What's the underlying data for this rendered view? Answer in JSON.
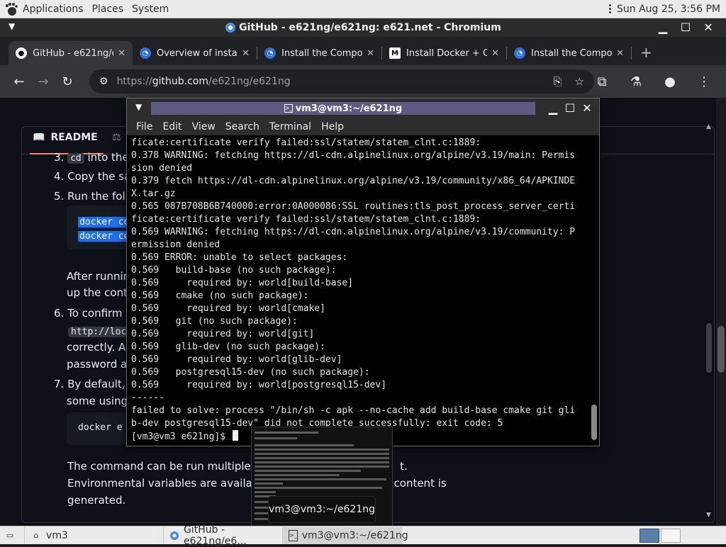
{
  "top_panel": {
    "applications_label": "Applications",
    "places_label": "Places",
    "system_label": "System",
    "clock": "Sun Aug 25,  3:56 PM"
  },
  "browser": {
    "window_title": "GitHub - e621ng/e621ng: e621.net - Chromium",
    "tabs": [
      {
        "title": "GitHub - e621ng/e",
        "favicon": "github-icon",
        "active": true
      },
      {
        "title": "Overview of insta",
        "favicon": "edge-icon",
        "active": false
      },
      {
        "title": "Install the Compo",
        "favicon": "edge-icon",
        "active": false
      },
      {
        "title": "Install Docker + C",
        "favicon": "m-icon",
        "active": false
      },
      {
        "title": "Install the Compo",
        "favicon": "edge-icon",
        "active": false
      }
    ],
    "address_scheme": "https://",
    "address_host": "github.com",
    "address_path": "/e621ng/e621ng"
  },
  "readme": {
    "tab_label": "README",
    "items": [
      {
        "num": "3.",
        "code": "cd",
        "text": " into the"
      },
      {
        "num": "4.",
        "text": "Copy the sa"
      },
      {
        "num": "5.",
        "text": "Run the follo"
      },
      {
        "num": "",
        "text": "After runnin"
      },
      {
        "num": "",
        "text": "up the conta"
      },
      {
        "num": "6.",
        "text": "To confirm t"
      },
      {
        "num": "",
        "code": "http://loc"
      },
      {
        "num": "",
        "text": "correctly. An"
      },
      {
        "num": "",
        "text": "password a"
      },
      {
        "num": "7.",
        "text": "By default, t"
      },
      {
        "num": "",
        "text": "some using"
      },
      {
        "num": "",
        "code": "docker e"
      }
    ],
    "code_block_lines": [
      "docker co",
      "docker co"
    ],
    "bottom_text": {
      "line1_start": "The command can be run multiple tin",
      "line1_end": "t.",
      "line2_start": "Environmental variables are availabl",
      "line2_end": "content is",
      "line3": "generated."
    }
  },
  "terminal": {
    "title": "vm3@vm3:~/e621ng",
    "menu": [
      "File",
      "Edit",
      "View",
      "Search",
      "Terminal",
      "Help"
    ],
    "lines": [
      "ficate:certificate verify failed:ssl/statem/statem_clnt.c:1889:",
      "0.378 WARNING: fetching https://dl-cdn.alpinelinux.org/alpine/v3.19/main: Permis",
      "sion denied",
      "0.379 fetch https://dl-cdn.alpinelinux.org/alpine/v3.19/community/x86_64/APKINDE",
      "X.tar.gz",
      "0.565 087B708B6B740000:error:0A000086:SSL routines:tls_post_process_server_certi",
      "ficate:certificate verify failed:ssl/statem/statem_clnt.c:1889:",
      "0.569 WARNING: fetching https://dl-cdn.alpinelinux.org/alpine/v3.19/community: P",
      "ermission denied",
      "0.569 ERROR: unable to select packages:",
      "0.569   build-base (no such package):",
      "0.569     required by: world[build-base]",
      "0.569   cmake (no such package):",
      "0.569     required by: world[cmake]",
      "0.569   git (no such package):",
      "0.569     required by: world[git]",
      "0.569   glib-dev (no such package):",
      "0.569     required by: world[glib-dev]",
      "0.569   postgresql15-dev (no such package):",
      "0.569     required by: world[postgresql15-dev]",
      "------",
      "failed to solve: process \"/bin/sh -c apk --no-cache add build-base cmake git gli",
      "b-dev postgresql15-dev\" did not complete successfully: exit code: 5"
    ],
    "prompt": "[vm3@vm3 e621ng]$ "
  },
  "preview": {
    "label": "vm3@vm3:~/e621ng"
  },
  "taskbar": {
    "items": [
      {
        "label": "vm3",
        "icon": "home-icon"
      },
      {
        "label": "GitHub - e621ng/e6...",
        "icon": "chromium-icon"
      },
      {
        "label": "vm3@vm3:~/e621ng",
        "icon": "terminal-icon"
      }
    ]
  },
  "colors": {
    "github_bg": "#0d1117",
    "terminal_bg": "#000000",
    "terminal_title_active": "#5d5a84",
    "selection_blue": "#1f6feb",
    "readme_underline": "#f78166"
  }
}
